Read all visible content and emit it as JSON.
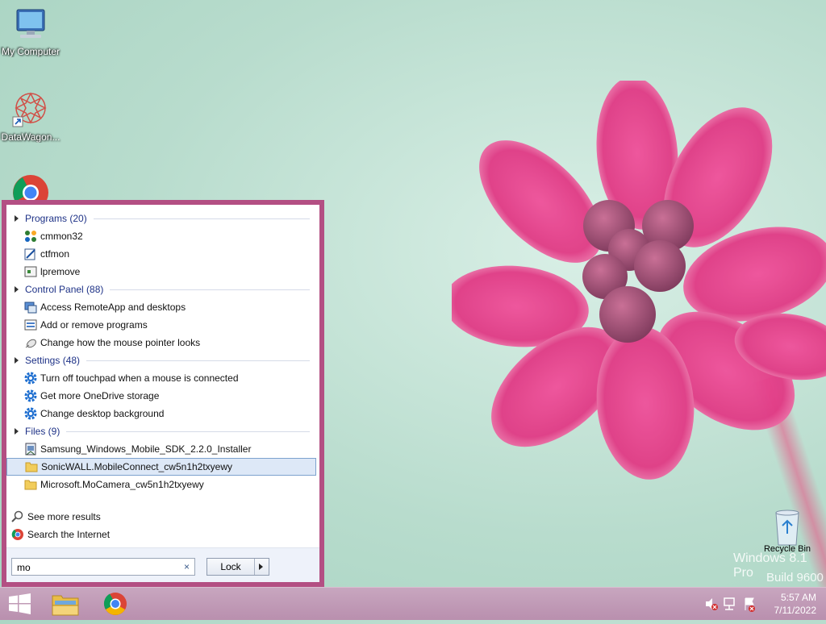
{
  "desktop": {
    "icons": [
      {
        "label": "My Computer",
        "icon": "my-computer-icon"
      },
      {
        "label": "DataWagon...",
        "icon": "datawagon-icon"
      },
      {
        "label": "Recycle Bin",
        "icon": "recycle-bin-icon"
      }
    ],
    "watermark": {
      "line1": "Windows 8.1 Pro",
      "line2": "Build 9600"
    }
  },
  "start_menu": {
    "groups": [
      {
        "title": "Programs (20)",
        "items": [
          {
            "label": "cmmon32",
            "icon": "cmmon32-icon"
          },
          {
            "label": "ctfmon",
            "icon": "ctfmon-icon"
          },
          {
            "label": "lpremove",
            "icon": "lpremove-icon"
          }
        ]
      },
      {
        "title": "Control Panel (88)",
        "items": [
          {
            "label": "Access RemoteApp and desktops",
            "icon": "remoteapp-icon"
          },
          {
            "label": "Add or remove programs",
            "icon": "programs-icon"
          },
          {
            "label": "Change how the mouse pointer looks",
            "icon": "mouse-icon"
          }
        ]
      },
      {
        "title": "Settings (48)",
        "items": [
          {
            "label": "Turn off touchpad when a mouse is connected",
            "icon": "gear-icon"
          },
          {
            "label": "Get more OneDrive storage",
            "icon": "gear-icon"
          },
          {
            "label": "Change desktop background",
            "icon": "gear-icon"
          }
        ]
      },
      {
        "title": "Files (9)",
        "items": [
          {
            "label": "Samsung_Windows_Mobile_SDK_2.2.0_Installer",
            "icon": "installer-icon"
          },
          {
            "label": "SonicWALL.MobileConnect_cw5n1h2txyewy",
            "icon": "folder-icon",
            "selected": true
          },
          {
            "label": "Microsoft.MoCamera_cw5n1h2txyewy",
            "icon": "folder-icon"
          }
        ]
      }
    ],
    "see_more": "See more results",
    "search_internet": "Search the Internet",
    "search": {
      "value": "mo",
      "clear": "×"
    },
    "lock_button": "Lock",
    "accent": "#b34f83"
  },
  "taskbar": {
    "items": [
      "start-icon",
      "file-explorer-icon",
      "chrome-icon"
    ],
    "clock": {
      "time": "5:57 AM",
      "date": "7/11/2022"
    }
  }
}
